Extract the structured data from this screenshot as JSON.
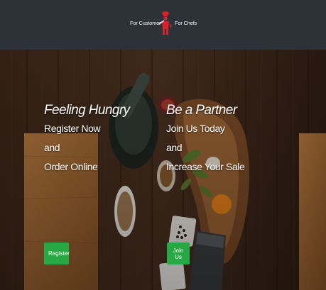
{
  "nav": {
    "customer_link": "For Customer",
    "chefs_link": "For Chefs",
    "logo_icon": "chef-logo-icon"
  },
  "customer": {
    "headline": "Feeling Hungry",
    "line1": "Register Now",
    "line2": "and",
    "line3": "Order Online",
    "button_label": "Register"
  },
  "chef": {
    "headline": "Be a Partner",
    "line1": "Join Us Today",
    "line2": "and",
    "line3": "Increase Your Sale",
    "button_label": "Join Us"
  },
  "colors": {
    "navbar_bg": "#2d3138",
    "button_green": "#28a745",
    "logo_red": "#d8232a"
  }
}
